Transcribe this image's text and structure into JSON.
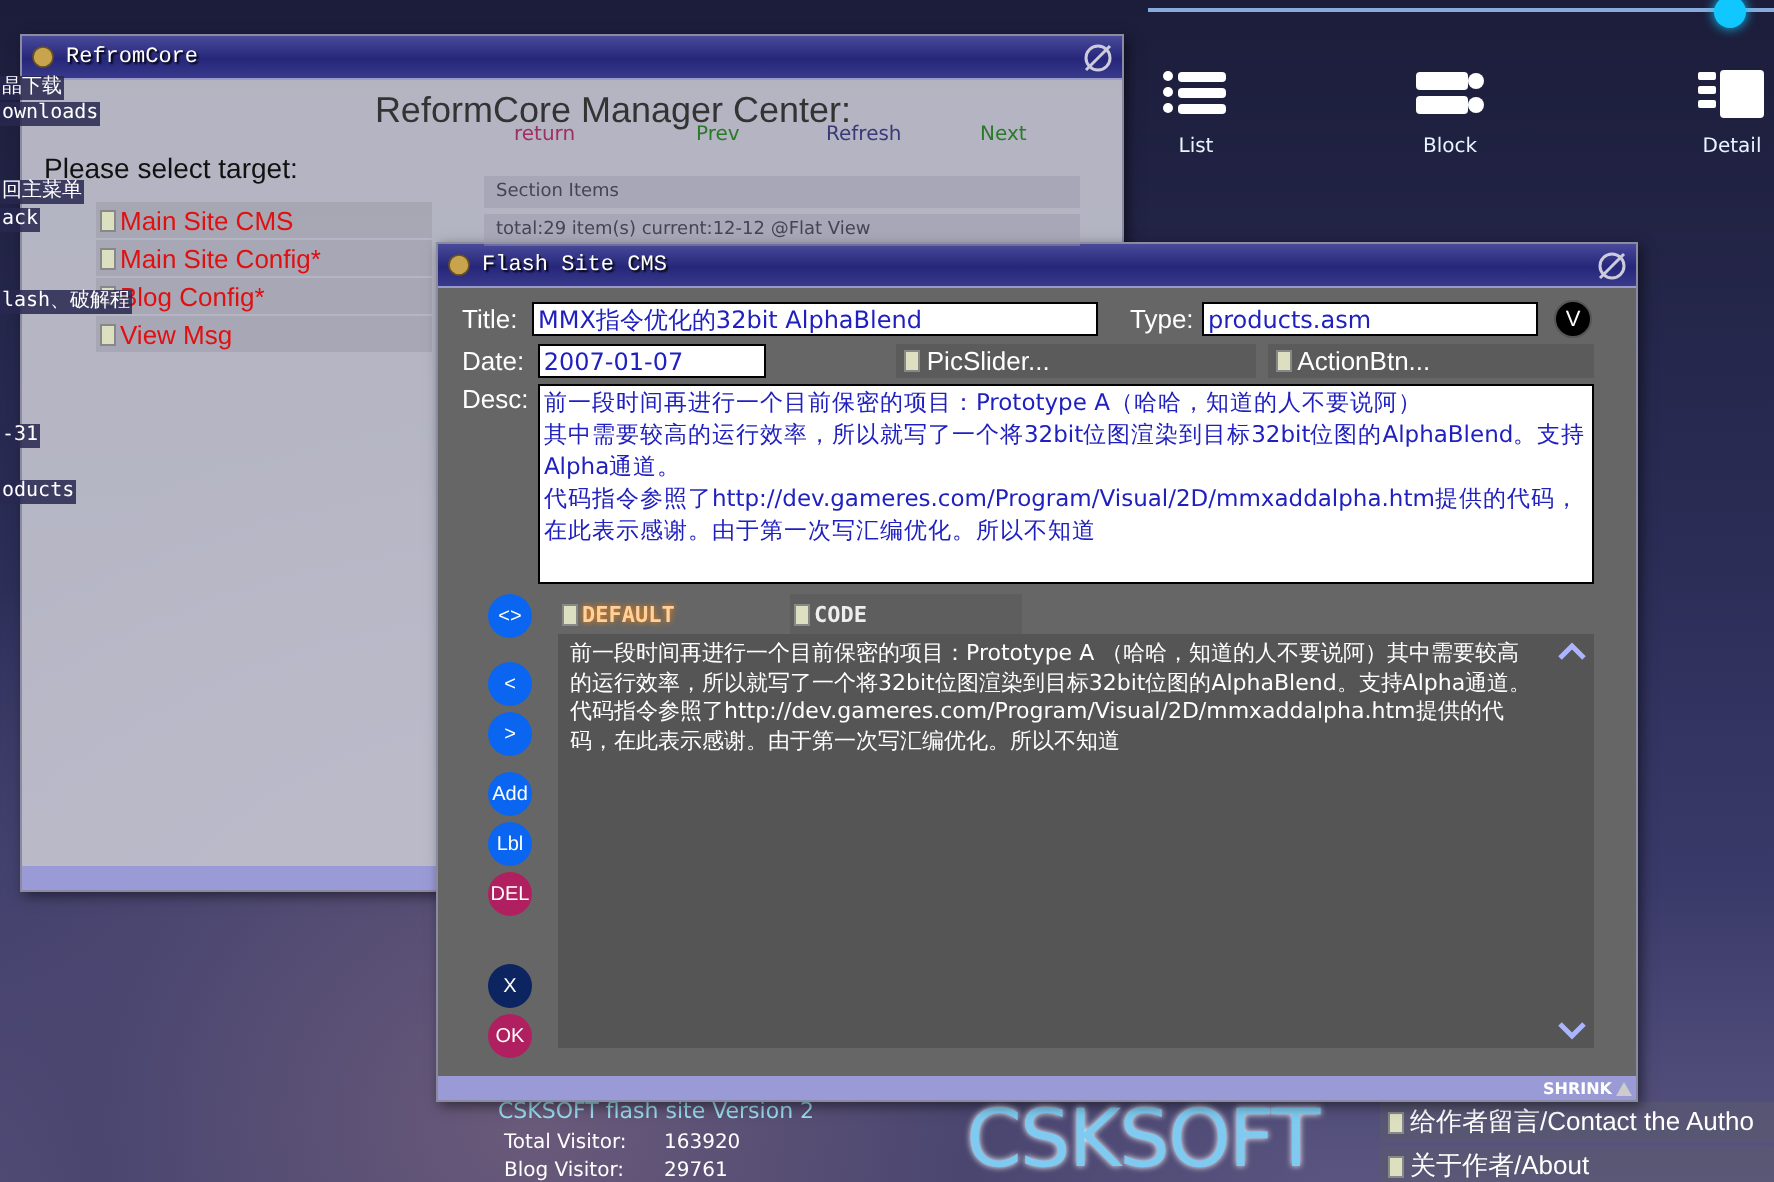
{
  "background": {
    "left_fragments": [
      "晶下载",
      "ownloads",
      "回主菜单",
      "ack",
      "lash、破解程",
      "-31",
      "oducts"
    ],
    "toolbar": [
      {
        "label": "return",
        "kind": "return"
      },
      {
        "label": "Prev",
        "kind": "prev"
      },
      {
        "label": "Refresh",
        "kind": "refresh"
      },
      {
        "label": "Next",
        "kind": "next"
      }
    ],
    "view_modes": [
      {
        "label": "List",
        "kind": "list"
      },
      {
        "label": "Block",
        "kind": "block"
      },
      {
        "label": "Detail",
        "kind": "detail"
      }
    ],
    "section_title": "Section Items",
    "section_status": "total:29 item(s) current:12-12 @Flat View",
    "footer": {
      "version": "CSKSOFT flash site Version 2",
      "stats": [
        {
          "label": "Total Visitor:",
          "value": "163920"
        },
        {
          "label": "Blog Visitor:",
          "value": "29761"
        }
      ],
      "logo": "CSKSOFT",
      "links": [
        "给作者留言/Contact the Autho",
        "关于作者/About"
      ]
    }
  },
  "manager_window": {
    "title": "RefromCore",
    "heading": "ReformCore Manager Center:",
    "prompt": "Please select target:",
    "targets": [
      "Main Site CMS",
      "Main Site Config*",
      "Blog Config*",
      "View Msg"
    ]
  },
  "cms_window": {
    "title": "Flash Site CMS",
    "title_field": {
      "label": "Title:",
      "value": "MMX指令优化的32bit AlphaBlend"
    },
    "type_field": {
      "label": "Type:",
      "value": "products.asm",
      "button": "V"
    },
    "date_field": {
      "label": "Date:",
      "value": "2007-01-07"
    },
    "action_buttons": [
      "PicSlider...",
      "ActionBtn..."
    ],
    "desc_field": {
      "label": "Desc:",
      "lines": [
        "前一段时间再进行一个目前保密的项目：Prototype A（哈哈，知道的人不要说阿）",
        "其中需要较高的运行效率，所以就写了一个将32bit位图渲染到目标32bit位图的AlphaBlend。支持Alpha通道。",
        "代码指令参照了http://dev.gameres.com/Program/Visual/2D/mmxaddalpha.htm提供的代码，在此表示感谢。由于第一次写汇编优化。所以不知道"
      ]
    },
    "side_button_groups": [
      [
        {
          "label": "<>",
          "kind": "blue"
        }
      ],
      [
        {
          "label": "<",
          "kind": "blue"
        },
        {
          "label": ">",
          "kind": "blue"
        }
      ],
      [
        {
          "label": "Add",
          "kind": "blue"
        },
        {
          "label": "Lbl",
          "kind": "blue"
        },
        {
          "label": "DEL",
          "kind": "red"
        }
      ],
      [
        {
          "label": "X",
          "kind": "navy"
        },
        {
          "label": "OK",
          "kind": "red"
        }
      ]
    ],
    "tabs": [
      {
        "label": "DEFAULT",
        "selected": true
      },
      {
        "label": "CODE",
        "selected": false
      }
    ],
    "editor_text": "前一段时间再进行一个目前保密的项目：Prototype A （哈哈，知道的人不要说阿）其中需要较高的运行效率，所以就写了一个将32bit位图渲染到目标32bit位图的AlphaBlend。支持Alpha通道。代码指令参照了http://dev.gameres.com/Program/Visual/2D/mmxaddalpha.htm提供的代码，在此表示感谢。由于第一次写汇编优化。所以不知道",
    "shrink": "SHRINK"
  }
}
